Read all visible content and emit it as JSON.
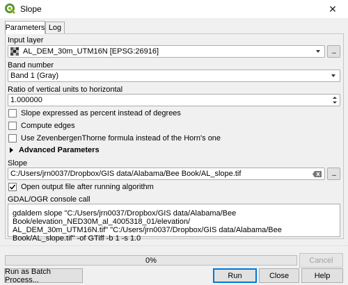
{
  "window": {
    "title": "Slope",
    "app_icon": "qgis-icon",
    "close_glyph": "✕"
  },
  "tabs": [
    {
      "label": "Parameters",
      "active": true
    },
    {
      "label": "Log",
      "active": false
    }
  ],
  "params": {
    "input_layer_label": "Input layer",
    "input_layer_value": "AL_DEM_30m_UTM16N [EPSG:26916]",
    "input_layer_icon": "raster-layer-icon",
    "browse_label": "...",
    "band_label": "Band number",
    "band_value": "Band 1 (Gray)",
    "ratio_label": "Ratio of vertical units to horizontal",
    "ratio_value": "1.000000",
    "checkbox_percent": {
      "label": "Slope expressed as percent instead of degrees",
      "checked": false
    },
    "checkbox_edges": {
      "label": "Compute edges",
      "checked": false
    },
    "checkbox_zt": {
      "label": "Use ZevenbergenThorne formula instead of the Horn's one",
      "checked": false
    },
    "advanced_label": "Advanced Parameters",
    "slope_label": "Slope",
    "slope_value": "C:/Users/jrn0037/Dropbox/GIS data/Alabama/Bee Book/AL_slope.tif",
    "slope_browse_label": "...",
    "open_output": {
      "label": "Open output file after running algorithm",
      "checked": true
    },
    "console_label": "GDAL/OGR console call",
    "console_text": "gdaldem slope \"C:/Users/jrn0037/Dropbox/GIS data/Alabama/Bee Book/elevation_NED30M_al_4005318_01/elevation/\nAL_DEM_30m_UTM16N.tif\" \"C:/Users/jrn0037/Dropbox/GIS data/Alabama/Bee Book/AL_slope.tif\" -of GTiff -b 1 -s 1.0"
  },
  "progress": {
    "value": 0,
    "text": "0%",
    "cancel_label": "Cancel"
  },
  "buttons": {
    "batch": "Run as Batch Process...",
    "run": "Run",
    "close": "Close",
    "help": "Help"
  },
  "colors": {
    "accent": "#0078d7",
    "progress_fill": "#06b025"
  }
}
